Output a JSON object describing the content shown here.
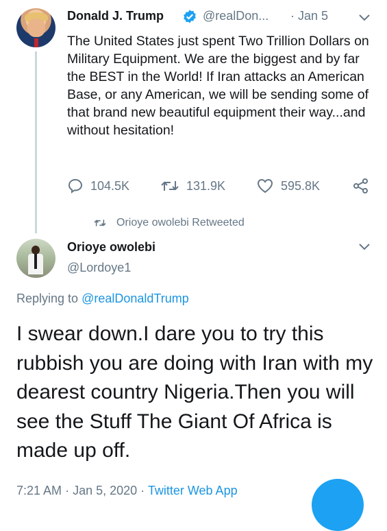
{
  "original_tweet": {
    "author_name": "Donald J. Trump",
    "handle": "@realDon...",
    "date_sep": "·",
    "date": "Jan 5",
    "text": "The United States just spent Two Trillion Dollars on Military Equipment. We are the biggest and by far the BEST in the World! If Iran attacks an American Base, or any American, we will be sending some of that brand new beautiful equipment their way...and without hesitation!",
    "replies": "104.5K",
    "retweets": "131.9K",
    "likes": "595.8K",
    "verified": true
  },
  "retweeted_by": "Orioye owolebi Retweeted",
  "reply": {
    "author_name": "Orioye owolebi",
    "handle": "@Lordoye1",
    "replying_prefix": "Replying to ",
    "replying_to": "@realDonaldTrump",
    "text": "I swear down.I dare you to try this rubbish you are doing with Iran with my dearest country Nigeria.Then you will see the Stuff The  Giant Of Africa is made up off.",
    "time": "7:21 AM",
    "sep": "·",
    "date": "Jan 5, 2020",
    "app": "Twitter Web App"
  },
  "icons": {
    "reply": "reply-icon",
    "retweet": "retweet-icon",
    "like": "heart-icon",
    "share": "share-icon",
    "verified": "verified-badge-icon",
    "more": "chevron-down-icon"
  },
  "colors": {
    "text": "#14171a",
    "secondary": "#657786",
    "link": "#1b95e0",
    "accent": "#1da1f2",
    "thread_line": "#ccd6dd"
  }
}
